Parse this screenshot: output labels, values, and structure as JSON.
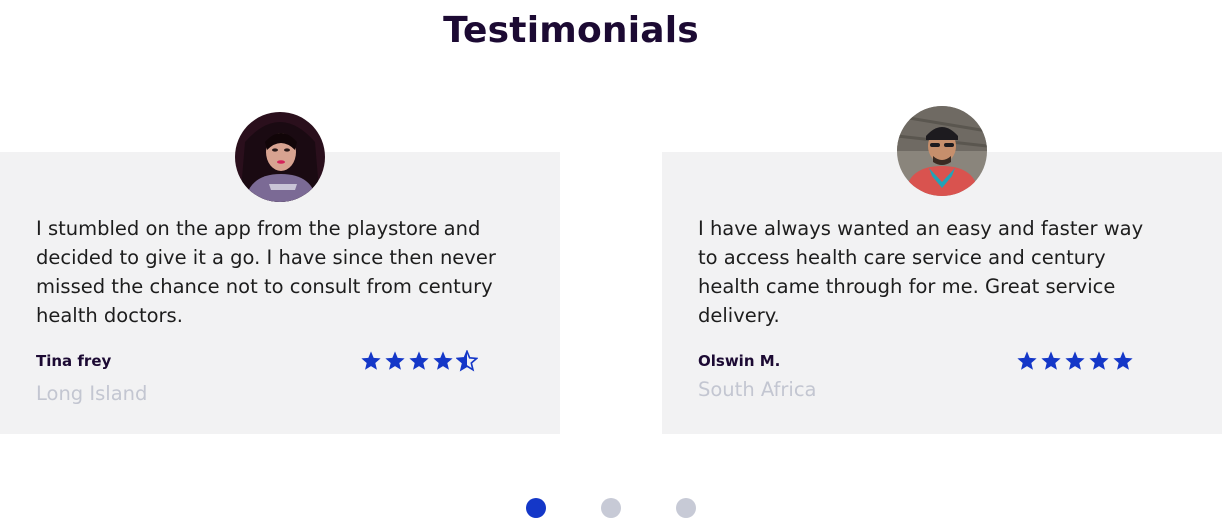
{
  "section": {
    "title": "Testimonials"
  },
  "testimonials": [
    {
      "quote": "I stumbled on the app from the playstore and decided to give it a go. I have since then never missed the chance not to consult from century health doctors.",
      "name": "Tina frey",
      "location": "Long Island",
      "rating": 4.5
    },
    {
      "quote": "I have always wanted an easy and faster way to access health care service and century health came through for me. Great service delivery.",
      "name": "Olswin M.",
      "location": "South Africa",
      "rating": 5
    }
  ],
  "pagination": {
    "active_index": 0,
    "count": 3
  },
  "colors": {
    "title": "#1c0a33",
    "card_bg": "#f2f2f3",
    "star": "#1437c8",
    "location": "#c3c6d1",
    "dot_active": "#1437c8",
    "dot_inactive": "#c7cad6"
  }
}
